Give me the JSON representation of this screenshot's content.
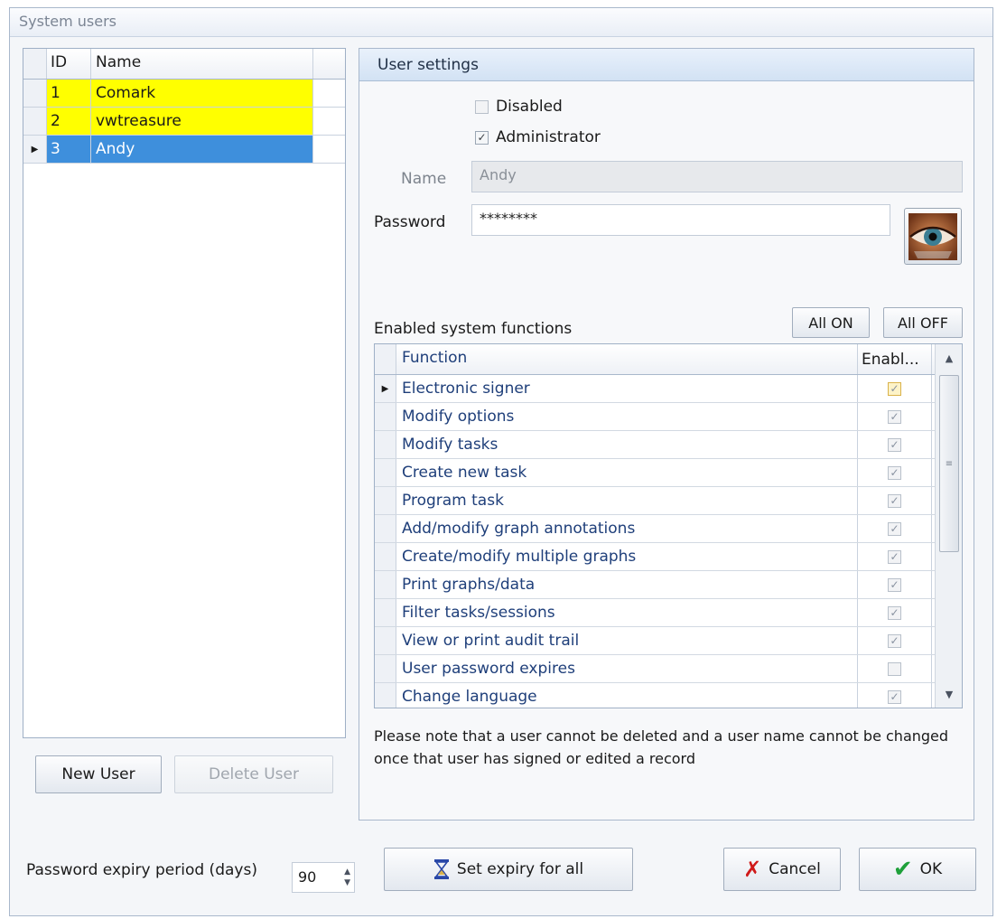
{
  "window": {
    "title": "System users"
  },
  "users_grid": {
    "columns": [
      "ID",
      "Name"
    ],
    "rows": [
      {
        "id": "1",
        "name": "Comark",
        "highlight": "yellow"
      },
      {
        "id": "2",
        "name": "vwtreasure",
        "highlight": "yellow"
      },
      {
        "id": "3",
        "name": "Andy",
        "highlight": "selected"
      }
    ]
  },
  "user_buttons": {
    "new_user": "New User",
    "delete_user": "Delete User"
  },
  "settings": {
    "header": "User settings",
    "disabled_label": "Disabled",
    "disabled_checked": false,
    "administrator_label": "Administrator",
    "administrator_checked": true,
    "name_label": "Name",
    "name_value": "Andy",
    "password_label": "Password",
    "password_value": "********",
    "functions_label": "Enabled system functions",
    "all_on": "All ON",
    "all_off": "All OFF",
    "functions_columns": [
      "Function",
      "Enabl..."
    ],
    "functions": [
      {
        "name": "Electronic signer",
        "enabled": true,
        "current": true
      },
      {
        "name": "Modify options",
        "enabled": true
      },
      {
        "name": "Modify tasks",
        "enabled": true
      },
      {
        "name": "Create new task",
        "enabled": true
      },
      {
        "name": "Program task",
        "enabled": true
      },
      {
        "name": "Add/modify graph annotations",
        "enabled": true
      },
      {
        "name": "Create/modify multiple graphs",
        "enabled": true
      },
      {
        "name": "Print graphs/data",
        "enabled": true
      },
      {
        "name": "Filter tasks/sessions",
        "enabled": true
      },
      {
        "name": "View or print audit trail",
        "enabled": true
      },
      {
        "name": "User password expires",
        "enabled": false
      },
      {
        "name": "Change language",
        "enabled": true
      }
    ],
    "note": "Please note that a user cannot be deleted and a user name cannot be changed once that user has signed or edited a record"
  },
  "footer": {
    "expiry_label": "Password expiry period (days)",
    "expiry_value": "90",
    "set_expiry": "Set expiry for all",
    "cancel": "Cancel",
    "ok": "OK"
  },
  "icons": {
    "checkmark": "check-icon",
    "row_pointer": "row-pointer-icon",
    "eye": "eye-icon",
    "hourglass": "hourglass-icon",
    "cancel": "red-x-icon",
    "ok": "green-check-icon"
  },
  "colors": {
    "row_yellow": "#ffff00",
    "row_selected": "#3e8fdc",
    "header_blue": "#d2e2f4"
  }
}
